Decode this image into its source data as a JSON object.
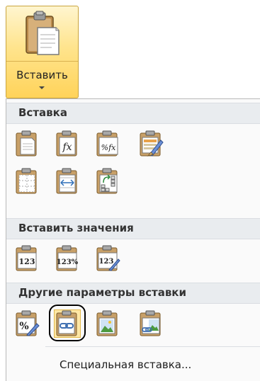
{
  "ribbon": {
    "paste_label": "Вставить"
  },
  "menu": {
    "sections": [
      {
        "title": "Вставка"
      },
      {
        "title": "Вставить значения"
      },
      {
        "title": "Другие параметры вставки"
      }
    ],
    "paste_icons": {
      "formulas": "fx",
      "formulas_number": "%fx"
    },
    "values_icons": {
      "values": "123",
      "values_number": "123%",
      "values_source": "123"
    },
    "other_icons": {
      "formatting": "%",
      "link": "link-icon",
      "picture": "picture-icon",
      "linked_picture": "linked-picture-icon"
    },
    "selected_item": "paste-link",
    "special_label": "Специальная вставка..."
  },
  "colors": {
    "ribbon_highlight": "#ffd35a",
    "section_header": "#e9ecef",
    "circle_annotation": "#000000"
  }
}
